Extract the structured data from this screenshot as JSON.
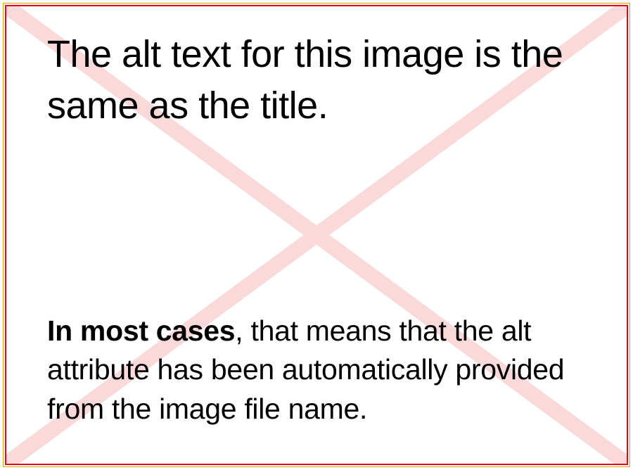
{
  "main": {
    "top_text": "The alt text for this image is the same as the title.",
    "bottom_bold": "In most cases",
    "bottom_rest": ", that means that the alt attribute has been automatically provided from the image file name."
  },
  "colors": {
    "outer_border": "#d4a800",
    "inner_border": "#e30613",
    "cross": "#f9d9d9"
  }
}
